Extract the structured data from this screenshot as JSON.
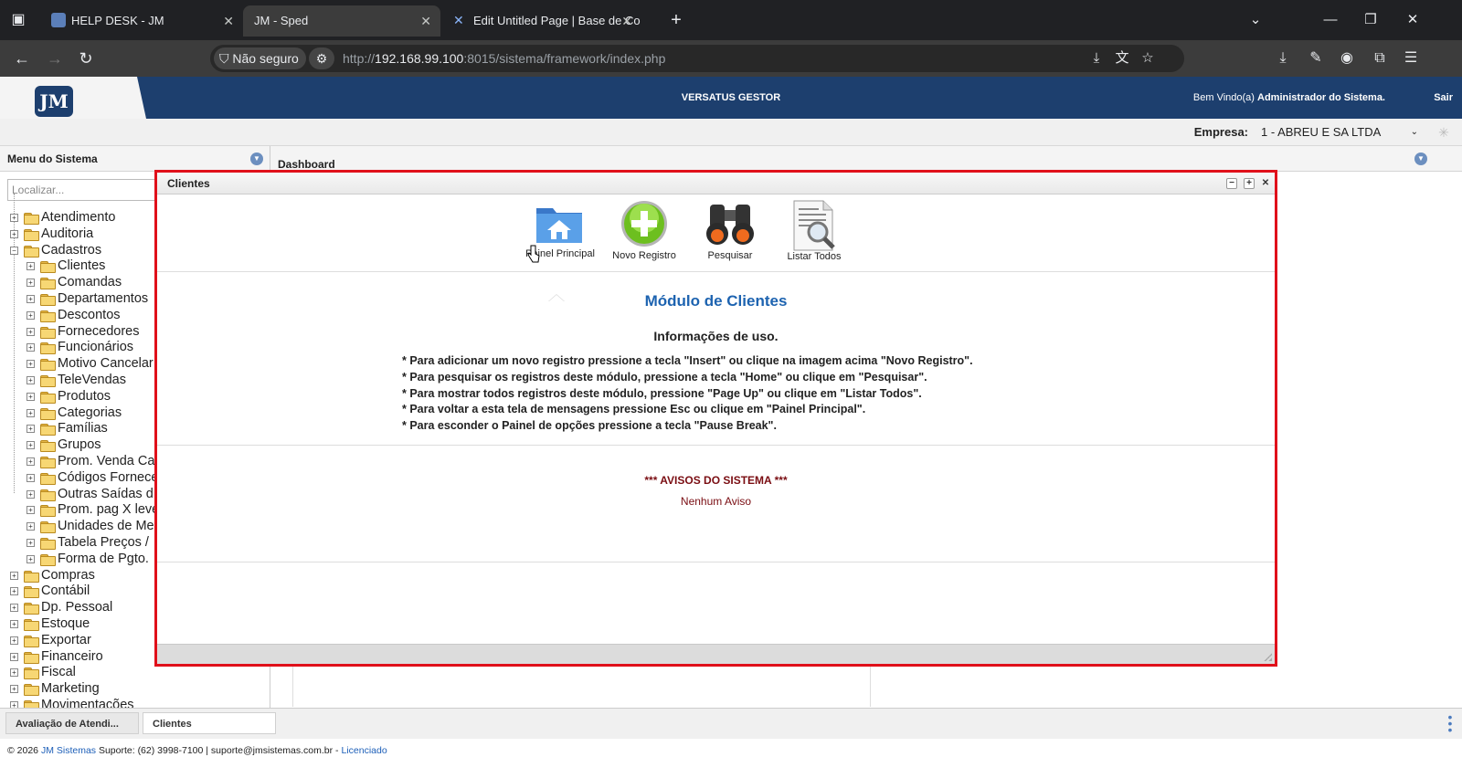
{
  "browser": {
    "tabs": [
      {
        "title": "HELP DESK - JM"
      },
      {
        "title": "JM - Sped"
      },
      {
        "title": "Edit Untitled Page | Base de Co"
      }
    ],
    "security_label": "Não seguro",
    "url_prefix": "http://",
    "url_host": "192.168.99.100",
    "url_rest": ":8015/sistema/framework/index.php"
  },
  "app": {
    "logo_text": "JM",
    "title": "VERSATUS GESTOR",
    "welcome_prefix": "Bem Vindo(a)",
    "user_name": "Administrador do Sistema.",
    "logout_label": "Sair",
    "company_label": "Empresa:",
    "company_value": "1 - ABREU E SA LTDA"
  },
  "sidebar": {
    "title": "Menu do Sistema",
    "search_placeholder": "Localizar...",
    "tree": [
      {
        "label": "Atendimento",
        "level": 0,
        "expanded": false
      },
      {
        "label": "Auditoria",
        "level": 0,
        "expanded": false
      },
      {
        "label": "Cadastros",
        "level": 0,
        "expanded": true
      },
      {
        "label": "Clientes",
        "level": 1,
        "expanded": false
      },
      {
        "label": "Comandas",
        "level": 1,
        "expanded": false
      },
      {
        "label": "Departamentos",
        "level": 1,
        "expanded": false
      },
      {
        "label": "Descontos",
        "level": 1,
        "expanded": false
      },
      {
        "label": "Fornecedores",
        "level": 1,
        "expanded": false
      },
      {
        "label": "Funcionários",
        "level": 1,
        "expanded": false
      },
      {
        "label": "Motivo Cancelar",
        "level": 1,
        "expanded": false
      },
      {
        "label": "TeleVendas",
        "level": 1,
        "expanded": false
      },
      {
        "label": "Produtos",
        "level": 1,
        "expanded": false
      },
      {
        "label": "Categorias",
        "level": 1,
        "expanded": false
      },
      {
        "label": "Famílias",
        "level": 1,
        "expanded": false
      },
      {
        "label": "Grupos",
        "level": 1,
        "expanded": false
      },
      {
        "label": "Prom. Venda Ca",
        "level": 1,
        "expanded": false
      },
      {
        "label": "Códigos Fornece",
        "level": 1,
        "expanded": false
      },
      {
        "label": "Outras Saídas d",
        "level": 1,
        "expanded": false
      },
      {
        "label": "Prom. pag X leve",
        "level": 1,
        "expanded": false
      },
      {
        "label": "Unidades de Me",
        "level": 1,
        "expanded": false
      },
      {
        "label": "Tabela Preços / ",
        "level": 1,
        "expanded": false
      },
      {
        "label": "Forma de Pgto.",
        "level": 1,
        "expanded": false
      },
      {
        "label": "Compras",
        "level": 0,
        "expanded": false
      },
      {
        "label": "Contábil",
        "level": 0,
        "expanded": false
      },
      {
        "label": "Dp. Pessoal",
        "level": 0,
        "expanded": false
      },
      {
        "label": "Estoque",
        "level": 0,
        "expanded": false
      },
      {
        "label": "Exportar",
        "level": 0,
        "expanded": false
      },
      {
        "label": "Financeiro",
        "level": 0,
        "expanded": false
      },
      {
        "label": "Fiscal",
        "level": 0,
        "expanded": false
      },
      {
        "label": "Marketing",
        "level": 0,
        "expanded": false
      },
      {
        "label": "Movimentações",
        "level": 0,
        "expanded": false
      }
    ]
  },
  "main": {
    "dashboard_title": "Dashboard"
  },
  "window": {
    "title": "Clientes",
    "toolbar": [
      {
        "label": "Painel Principal",
        "icon": "home-folder-icon"
      },
      {
        "label": "Novo Registro",
        "icon": "add-icon"
      },
      {
        "label": "Pesquisar",
        "icon": "binoculars-icon"
      },
      {
        "label": "Listar Todos",
        "icon": "list-search-icon"
      }
    ],
    "module_title": "Módulo de Clientes",
    "usage_title": "Informações de uso.",
    "usage_lines": [
      "* Para adicionar um novo registro pressione a tecla \"Insert\" ou clique na imagem acima \"Novo Registro\".",
      "* Para pesquisar os registros deste módulo, pressione a tecla \"Home\" ou clique em \"Pesquisar\".",
      "* Para mostrar todos registros deste módulo, pressione \"Page Up\" ou clique em \"Listar Todos\".",
      "* Para voltar a esta tela de mensagens pressione Esc ou clique em \"Painel Principal\".",
      "* Para esconder o Painel de opções pressione a tecla \"Pause Break\"."
    ],
    "avisos_title": "*** AVISOS DO SISTEMA ***",
    "avisos_text": "Nenhum Aviso"
  },
  "taskbar": {
    "tasks": [
      {
        "label": "Avaliação de Atendi..."
      },
      {
        "label": "Clientes"
      }
    ]
  },
  "footer": {
    "copyright": "© 2026",
    "company_link": "JM Sistemas",
    "support_text": "Suporte: (62) 3998-7100 | suporte@jmsistemas.com.br -",
    "license_link": "Licenciado"
  },
  "colors": {
    "header_blue": "#1d3f6e",
    "module_title": "#1d63b0",
    "avisos": "#7a0d12",
    "highlight_border": "#e0101a"
  }
}
